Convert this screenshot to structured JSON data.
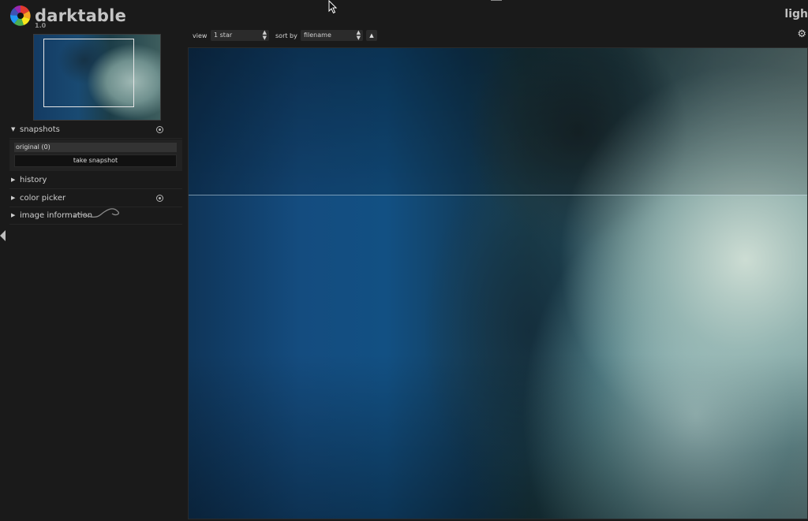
{
  "app": {
    "name": "darktable",
    "version": "1.0",
    "view_title": "ligh"
  },
  "navigation": {},
  "modules": {
    "snapshots": {
      "label": "snapshots",
      "expanded": true
    },
    "history": {
      "label": "history",
      "expanded": false
    },
    "color_picker": {
      "label": "color picker",
      "expanded": false
    },
    "image_information": {
      "label": "image information",
      "expanded": false
    }
  },
  "snapshots": {
    "items": [
      {
        "label": "original (0)"
      }
    ],
    "take_snapshot_label": "take snapshot"
  },
  "filterbar": {
    "view_label": "view",
    "view_value": "1 star",
    "sort_label": "sort by",
    "sort_value": "filename",
    "sort_dir_icon": "▲"
  },
  "icons": {
    "collapse_left": "triangle-left-icon",
    "settings": "gear-icon",
    "preset": "preset-icon"
  },
  "colors": {
    "background": "#1a1a1a",
    "text": "#cfcfcf",
    "panel": "#222222"
  }
}
